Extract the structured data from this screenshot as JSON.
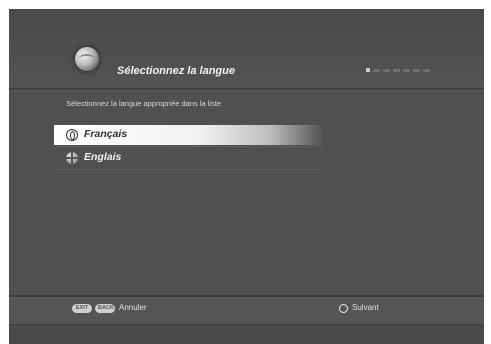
{
  "header": {
    "title": "Sélectionnez la langue",
    "icon": "globe-icon",
    "steps": {
      "total": 7,
      "current": 1
    }
  },
  "main": {
    "prompt": "Sélectionnez la langue appropriée dans la liste",
    "options": [
      {
        "label": "Français",
        "icon": "ring-icon",
        "selected": true
      },
      {
        "label": "Englais",
        "icon": "globe-icon",
        "selected": false
      }
    ]
  },
  "footer": {
    "exit_key": "EXIT",
    "back_key": "BACK",
    "cancel_label": "Annuler",
    "next_icon": "ok-ring-icon",
    "next_label": "Suivant"
  },
  "colors": {
    "background": "#505050",
    "highlight": "#ffffff",
    "text": "#f0f0f0"
  }
}
